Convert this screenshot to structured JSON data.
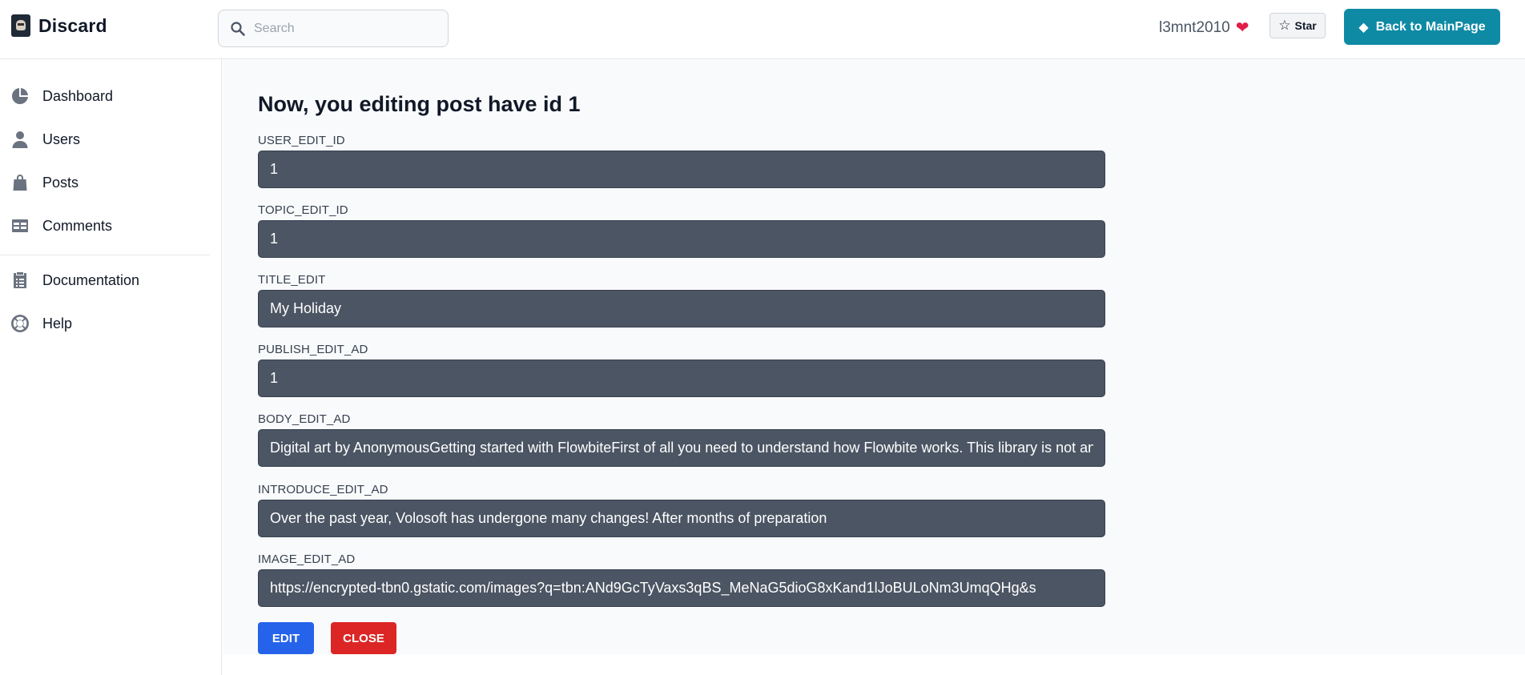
{
  "header": {
    "brand": "Discard",
    "search_placeholder": "Search",
    "username": "l3mnt2010",
    "heart": "❤",
    "star_label": "Star",
    "main_button_label": "Back to MainPage",
    "accent_color": "#0e8aa5"
  },
  "sidebar": {
    "items": [
      {
        "label": "Dashboard",
        "icon": "pie-chart-icon"
      },
      {
        "label": "Users",
        "icon": "user-icon"
      },
      {
        "label": "Posts",
        "icon": "shopping-bag-icon"
      },
      {
        "label": "Comments",
        "icon": "table-icon"
      },
      {
        "label": "Documentation",
        "icon": "clipboard-list-icon"
      },
      {
        "label": "Help",
        "icon": "lifebuoy-icon"
      }
    ]
  },
  "main": {
    "title": "Now, you editing post have id 1",
    "fields": [
      {
        "label": "USER_EDIT_ID",
        "value": "1"
      },
      {
        "label": "TOPIC_EDIT_ID",
        "value": "1"
      },
      {
        "label": "TITLE_EDIT",
        "value": "My Holiday"
      },
      {
        "label": "PUBLISH_EDIT_AD",
        "value": "1"
      },
      {
        "label": "BODY_EDIT_AD",
        "value": "Digital art by AnonymousGetting started with FlowbiteFirst of all you need to understand how Flowbite works. This library is not an"
      },
      {
        "label": "INTRODUCE_EDIT_AD",
        "value": "Over the past year, Volosoft has undergone many changes! After months of preparation"
      },
      {
        "label": "IMAGE_EDIT_AD",
        "value": "https://encrypted-tbn0.gstatic.com/images?q=tbn:ANd9GcTyVaxs3qBS_MeNaG5dioG8xKand1lJoBULoNm3UmqQHg&s"
      }
    ],
    "edit_label": "EDIT",
    "close_label": "CLOSE",
    "edit_color": "#2563eb",
    "close_color": "#dc2626"
  }
}
